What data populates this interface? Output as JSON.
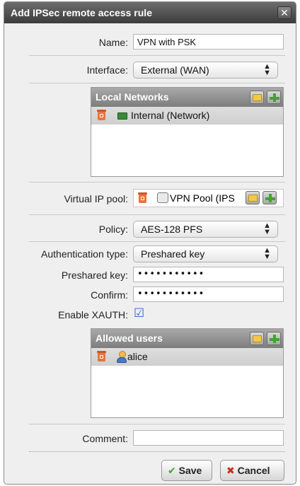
{
  "dialog": {
    "title": "Add IPSec remote access rule",
    "close": "✕"
  },
  "form": {
    "name": {
      "label": "Name:",
      "value": "VPN with PSK"
    },
    "interface": {
      "label": "Interface:",
      "value": "External (WAN)"
    },
    "local_networks": {
      "title": "Local Networks",
      "items": [
        "Internal (Network)"
      ]
    },
    "virtual_ip_pool": {
      "label": "Virtual IP pool:",
      "value": "VPN Pool (IPS"
    },
    "policy": {
      "label": "Policy:",
      "value": "AES-128 PFS"
    },
    "auth_type": {
      "label": "Authentication type:",
      "value": "Preshared key"
    },
    "preshared_key": {
      "label": "Preshared key:",
      "value": "•••••••••••"
    },
    "confirm": {
      "label": "Confirm:",
      "value": "•••••••••••"
    },
    "xauth": {
      "label": "Enable XAUTH:",
      "checked": true,
      "check": "☑"
    },
    "allowed_users": {
      "title": "Allowed users",
      "items": [
        "alice"
      ]
    },
    "comment": {
      "label": "Comment:",
      "value": ""
    }
  },
  "buttons": {
    "save": "Save",
    "save_icon": "✔",
    "cancel": "Cancel",
    "cancel_icon": "✖"
  },
  "colors": {
    "accent_green": "#3fa52f",
    "cancel_red": "#cc2b1d"
  }
}
